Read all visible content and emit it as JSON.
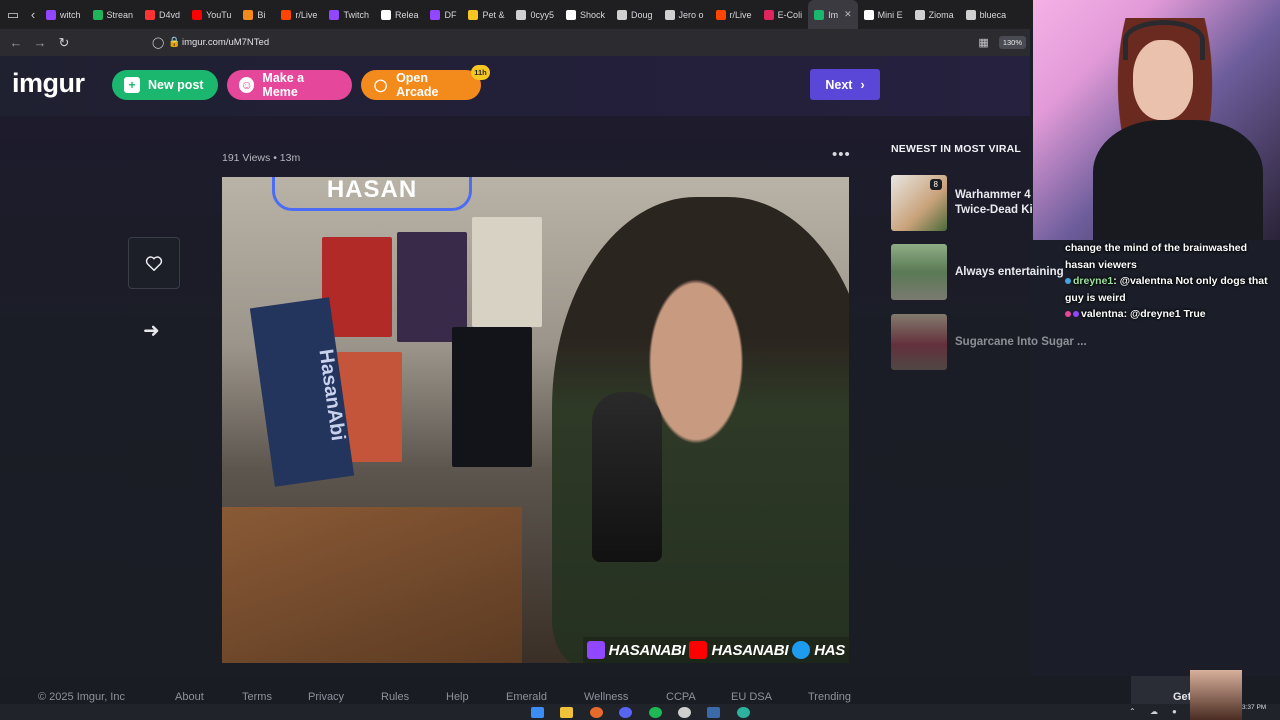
{
  "browser": {
    "tabs": [
      {
        "label": "witch",
        "color": "#9146ff"
      },
      {
        "label": "Strean",
        "color": "#1fb35a"
      },
      {
        "label": "D4vd",
        "color": "#ff3333"
      },
      {
        "label": "YouTu",
        "color": "#ff0000"
      },
      {
        "label": "Bi",
        "color": "#f28a1c"
      },
      {
        "label": "r/Live",
        "color": "#ff4500"
      },
      {
        "label": "Twitch",
        "color": "#9146ff"
      },
      {
        "label": "Relea",
        "color": "#ffffff"
      },
      {
        "label": "DF",
        "color": "#9146ff"
      },
      {
        "label": "Pet &",
        "color": "#f6c623"
      },
      {
        "label": "0cyy5",
        "color": "#d0d0d0"
      },
      {
        "label": "Shock",
        "color": "#ffffff"
      },
      {
        "label": "Doug",
        "color": "#d0d0d0"
      },
      {
        "label": "Jero o",
        "color": "#d0d0d0"
      },
      {
        "label": "r/Live",
        "color": "#ff4500"
      },
      {
        "label": "E-Coli",
        "color": "#e0245e"
      },
      {
        "label": "Im",
        "color": "#1bb76e",
        "active": true
      },
      {
        "label": "Mini E",
        "color": "#ffffff"
      },
      {
        "label": "Zioma",
        "color": "#d0d0d0"
      },
      {
        "label": "blueca",
        "color": "#d0d0d0"
      }
    ],
    "url": "imgur.com/uM7NTed",
    "zoom": "130%"
  },
  "header": {
    "logo": "imgur",
    "new_post": "New post",
    "make_meme": "Make a Meme",
    "open_arcade": "Open Arcade",
    "arcade_badge": "11h",
    "next": "Next"
  },
  "post": {
    "views": "191 Views",
    "age": "13m",
    "overlay": [
      "HASANABI",
      "HASANABI",
      "HAS"
    ],
    "neon_sign": "HASAN",
    "flag_text": "HasanAbi"
  },
  "sidebar": {
    "title": "NEWEST IN MOST VIRAL",
    "items": [
      {
        "title": "Warhammer 4 Twice-Dead Ki",
        "count": "8",
        "thumb": "#c9a27a"
      },
      {
        "title": "Always entertaining",
        "thumb": "#5a7a55"
      },
      {
        "title": "Sugarcane Into Sugar ...",
        "thumb": "#8a6a5c"
      }
    ]
  },
  "footer": {
    "links": [
      "© 2025 Imgur, Inc",
      "About",
      "Terms",
      "Privacy",
      "Rules",
      "Help",
      "Emerald",
      "Wellness",
      "CCPA",
      "EU DSA",
      "Trending"
    ],
    "get_app": "Get"
  },
  "chat": [
    {
      "user": "",
      "text": "change the mind of the brainwashed hasan viewers"
    },
    {
      "user": "dreyne1",
      "text": "@valentna Not only dogs that guy is weird"
    },
    {
      "user": "valentna",
      "text": "@dreyne1 True"
    }
  ],
  "clock": "3:37 PM"
}
